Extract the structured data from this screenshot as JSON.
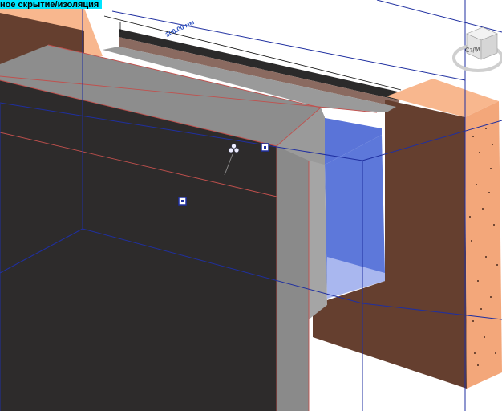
{
  "tag": {
    "label": "ное скрытие/изоляция"
  },
  "dimension": {
    "value": "300.00 мм"
  },
  "view_cube": {
    "face_label": "Сзди"
  },
  "colors": {
    "background": "#ffffff",
    "dark_face": "#2d2b2b",
    "gray_face": "#8d8d8d",
    "brick": "#653f2f",
    "brick_top": "#f8b78e",
    "insulation_blue": "#5c76d8",
    "grid_line": "#1f2fa0",
    "edge_red": "#c0504d",
    "tag_bg": "#00e5ff"
  }
}
